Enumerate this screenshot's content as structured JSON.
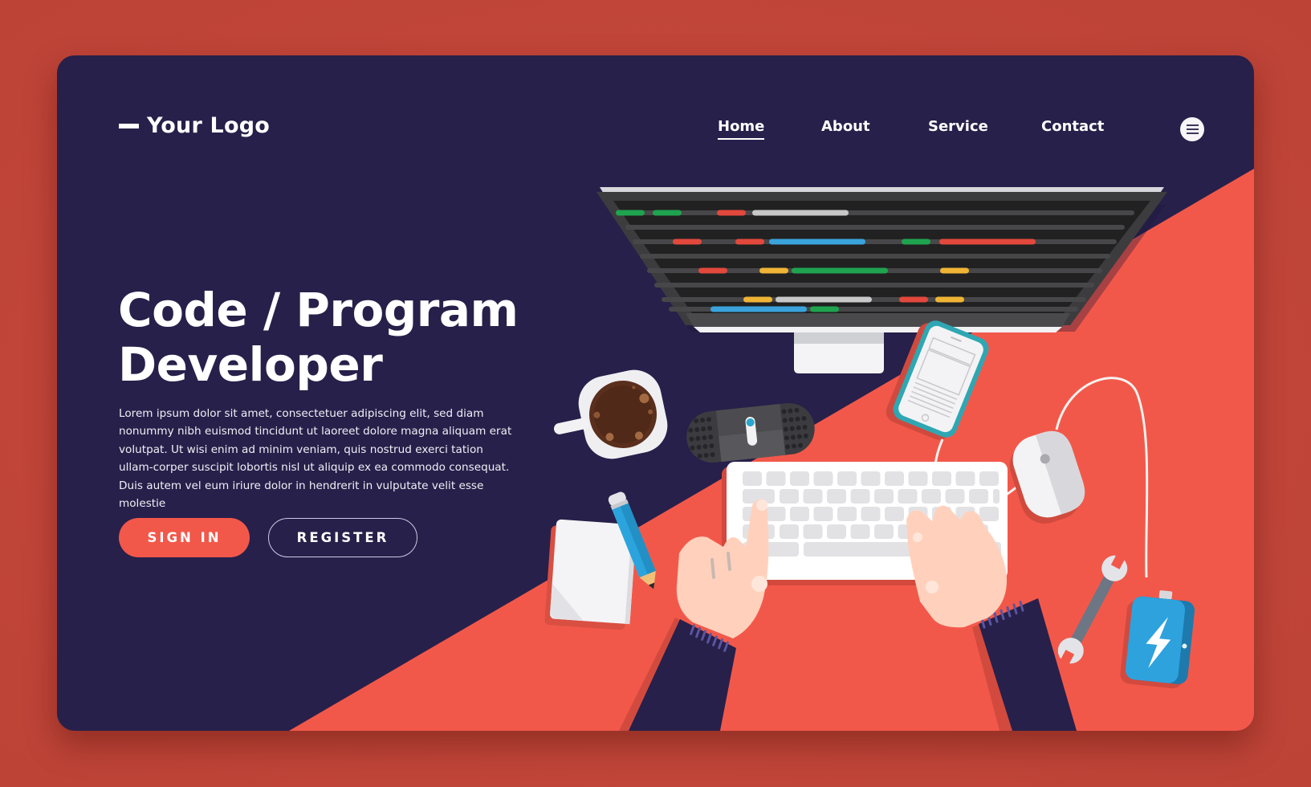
{
  "colors": {
    "page_background": "#c5483a",
    "card_navy": "#27204a",
    "accent_red": "#f2584a",
    "text_white": "#ffffff"
  },
  "header": {
    "logo_icon": "dash-bar-icon",
    "logo_text": "Your Logo",
    "nav": [
      {
        "label": "Home",
        "active": true
      },
      {
        "label": "About",
        "active": false
      },
      {
        "label": "Service",
        "active": false
      },
      {
        "label": "Contact",
        "active": false
      }
    ],
    "menu_icon": "hamburger-menu-icon"
  },
  "hero": {
    "title_line1": "Code / Program",
    "title_line2": "Developer",
    "body": "Lorem ipsum dolor sit amet, consectetuer adipiscing elit, sed diam nonummy nibh euismod tincidunt ut laoreet dolore magna aliquam erat volutpat. Ut wisi enim ad minim veniam, quis nostrud exerci tation ullam-corper suscipit lobortis nisl ut aliquip ex ea commodo consequat. Duis autem vel eum iriure dolor in hendrerit in vulputate velit esse molestie",
    "buttons": {
      "sign_in": "SIGN IN",
      "register": "REGISTER"
    }
  },
  "illustration": {
    "items": [
      "monitor-with-code",
      "coffee-cup",
      "speaker",
      "smartphone",
      "mouse",
      "keyboard",
      "hands",
      "notepad",
      "pencil",
      "wrench",
      "power-bank"
    ],
    "code_colors": {
      "green": "#1fa34f",
      "red": "#e2483c",
      "blue": "#3aa3dc",
      "yellow": "#efb435",
      "gray": "#c8c8c8",
      "line": "#474749"
    }
  }
}
